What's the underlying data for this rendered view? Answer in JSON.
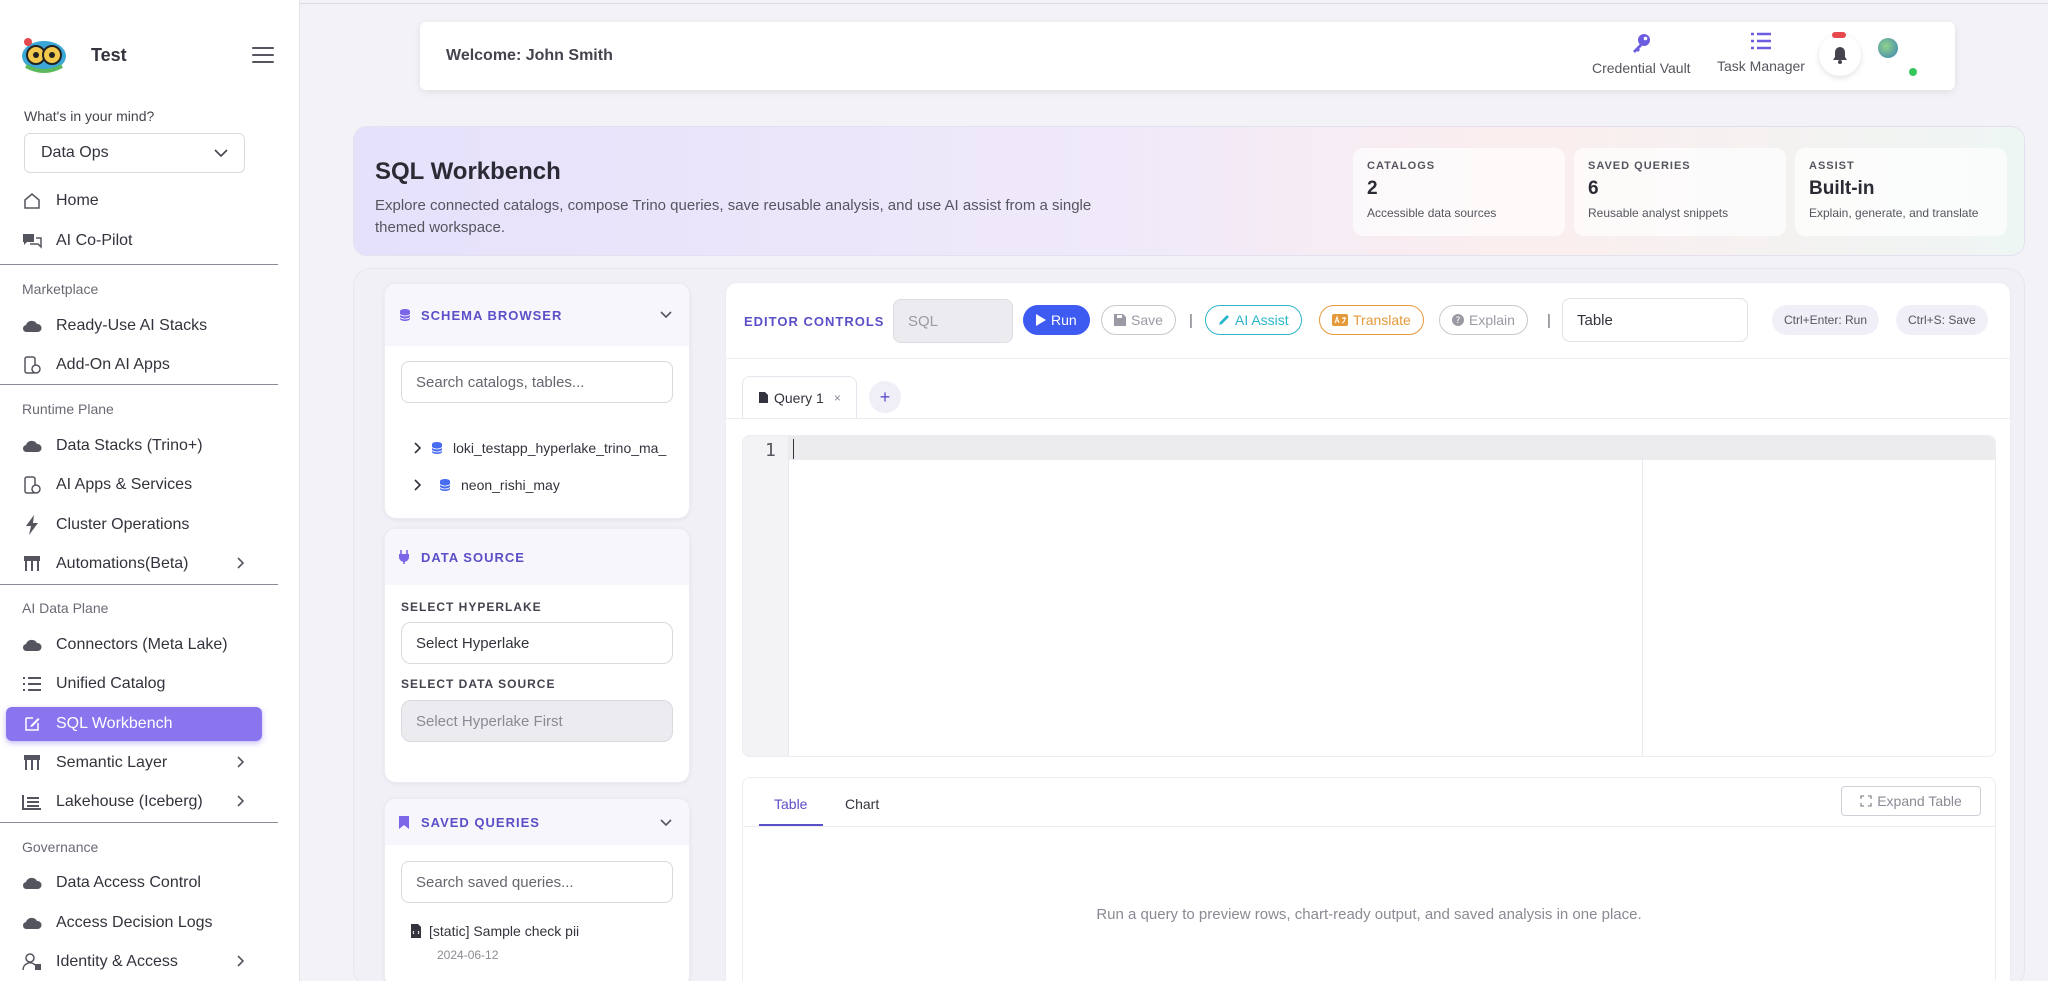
{
  "brand": {
    "name": "Test"
  },
  "mind": {
    "label": "What's in your mind?",
    "selected": "Data Ops"
  },
  "nav": {
    "home": "Home",
    "copilot": "AI Co-Pilot",
    "marketplace_label": "Marketplace",
    "ready_use": "Ready-Use AI Stacks",
    "addon": "Add-On AI Apps",
    "runtime_label": "Runtime Plane",
    "data_stacks": "Data Stacks (Trino+)",
    "ai_apps": "AI Apps & Services",
    "cluster_ops": "Cluster Operations",
    "automations": "Automations(Beta)",
    "ai_data_label": "AI Data Plane",
    "connectors": "Connectors (Meta Lake)",
    "unified_catalog": "Unified Catalog",
    "sql_workbench": "SQL Workbench",
    "semantic_layer": "Semantic Layer",
    "lakehouse": "Lakehouse (Iceberg)",
    "governance_label": "Governance",
    "data_access": "Data Access Control",
    "access_logs": "Access Decision Logs",
    "identity": "Identity & Access"
  },
  "header": {
    "welcome": "Welcome: John Smith",
    "credential_vault": "Credential Vault",
    "task_manager": "Task Manager"
  },
  "hero": {
    "title": "SQL Workbench",
    "description": "Explore connected catalogs, compose Trino queries, save reusable analysis, and use AI assist from a single themed workspace.",
    "stats": [
      {
        "label": "CATALOGS",
        "value": "2",
        "sub": "Accessible data sources"
      },
      {
        "label": "SAVED QUERIES",
        "value": "6",
        "sub": "Reusable analyst snippets"
      },
      {
        "label": "ASSIST",
        "value": "Built-in",
        "sub": "Explain, generate, and translate"
      }
    ]
  },
  "schema": {
    "title": "SCHEMA BROWSER",
    "search_placeholder": "Search catalogs, tables...",
    "items": [
      "loki_testapp_hyperlake_trino_ma_",
      "neon_rishi_may"
    ]
  },
  "datasource": {
    "title": "DATA SOURCE",
    "hyperlake_label": "SELECT HYPERLAKE",
    "hyperlake_value": "Select Hyperlake",
    "source_label": "SELECT DATA SOURCE",
    "source_value": "Select Hyperlake First"
  },
  "saved": {
    "title": "SAVED QUERIES",
    "search_placeholder": "Search saved queries...",
    "items": [
      {
        "name": "[static] Sample check pii",
        "date": "2024-06-12"
      }
    ]
  },
  "editor": {
    "controls_label": "EDITOR CONTROLS",
    "language": "SQL",
    "run": "Run",
    "save": "Save",
    "ai_assist": "AI Assist",
    "translate": "Translate",
    "explain": "Explain",
    "separator": "|",
    "view": "Table",
    "hint_run": "Ctrl+Enter: Run",
    "hint_save": "Ctrl+S: Save",
    "tab": "Query 1",
    "tab_close": "×",
    "add_tab": "+",
    "line_number": "1"
  },
  "results": {
    "tab_table": "Table",
    "tab_chart": "Chart",
    "expand": "Expand Table",
    "empty": "Run a query to preview rows, chart-ready output, and saved analysis in one place."
  },
  "colors": {
    "accent": "#8a75ef",
    "primary": "#3d5af1",
    "ai_assist": "#2bb5c9",
    "translate": "#e59a3a"
  }
}
